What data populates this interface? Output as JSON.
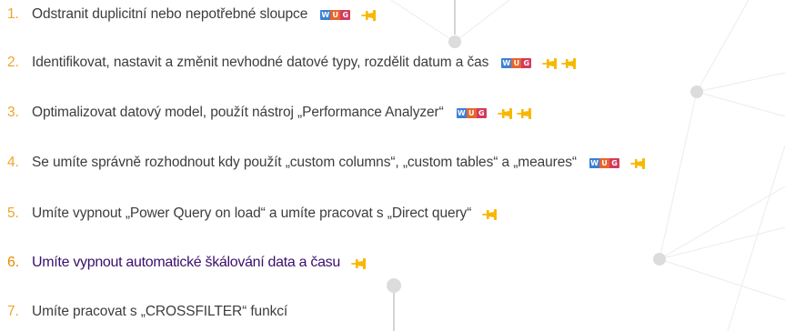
{
  "colors": {
    "number": "#f2a32a",
    "active_text": "#3b0f6b",
    "text": "#3d3d3d",
    "pin": "#f7b800",
    "badge_w": "#3a7fd6",
    "badge_u": "#e8652b",
    "badge_g": "#d23a5e"
  },
  "badge": {
    "w": "W",
    "u": "U",
    "g": "G"
  },
  "items": [
    {
      "num": "1.",
      "text": "Odstranit duplicitní nebo nepotřebné sloupce",
      "badge": true,
      "pins": 1
    },
    {
      "num": "2.",
      "text": "Identifikovat, nastavit a změnit nevhodné datové typy, rozdělit datum a čas",
      "badge": true,
      "pins": 2
    },
    {
      "num": "3.",
      "text": "Optimalizovat datový model, použít nástroj „Performance Analyzer“",
      "badge": true,
      "pins": 2
    },
    {
      "num": "4.",
      "text": "Se umíte správně rozhodnout kdy použít „custom columns“, „custom tables“ a „meaures“",
      "badge": true,
      "pins": 1
    },
    {
      "num": "5.",
      "text": "Umíte vypnout „Power Query on load“ a umíte pracovat s „Direct query“",
      "badge": false,
      "pins": 1
    },
    {
      "num": "6.",
      "text": "Umíte vypnout automatické škálování data a času",
      "badge": false,
      "pins": 1,
      "active": true
    },
    {
      "num": "7.",
      "text": "Umíte pracovat s „CROSSFILTER“ funkcí",
      "badge": false,
      "pins": 0
    }
  ]
}
